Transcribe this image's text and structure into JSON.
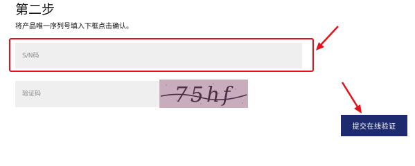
{
  "step": {
    "title": "第二步",
    "instruction": "将产品唯一序列号填入下框点击确认。"
  },
  "form": {
    "sn_placeholder": "S/N码",
    "captcha_placeholder": "验证码",
    "captcha_image_text": "75hf",
    "submit_label": "提交在线验证"
  },
  "colors": {
    "highlight": "#e8101a",
    "button_bg": "#1d2a6e",
    "field_bg": "#efefef"
  },
  "icons": {
    "annotation": "red-arrow"
  }
}
